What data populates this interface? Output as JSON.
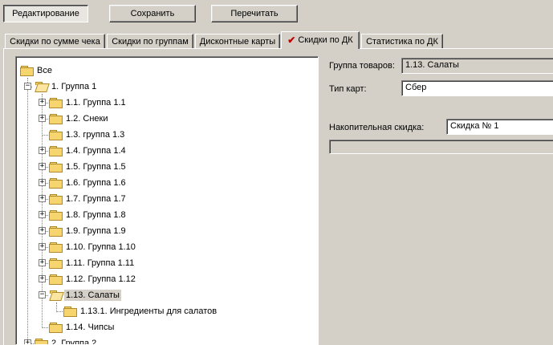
{
  "toolbar": {
    "edit_label": "Редактирование",
    "save_label": "Сохранить",
    "reload_label": "Перечитать"
  },
  "tabs": [
    {
      "label": "Скидки по сумме чека"
    },
    {
      "label": "Скидки по группам"
    },
    {
      "label": "Дисконтные карты"
    },
    {
      "label": "Скидки по ДК",
      "active": true
    },
    {
      "label": "Статистика по ДК"
    }
  ],
  "icons": {
    "check": "check-icon",
    "folder": "folder-icon",
    "expand": "plus-box-icon",
    "collapse": "minus-box-icon"
  },
  "tree": [
    {
      "label": "Все"
    },
    {
      "label": "1. Группа 1"
    },
    {
      "label": "1.1. Группа 1.1"
    },
    {
      "label": "1.2. Снеки"
    },
    {
      "label": "1.3. группа 1.3"
    },
    {
      "label": "1.4. Группа 1.4"
    },
    {
      "label": "1.5. Группа 1.5"
    },
    {
      "label": "1.6. Группа 1.6"
    },
    {
      "label": "1.7. Группа 1.7"
    },
    {
      "label": "1.8. Группа 1.8"
    },
    {
      "label": "1.9. Группа 1.9"
    },
    {
      "label": "1.10. Группа 1.10"
    },
    {
      "label": "1.11. Группа 1.11"
    },
    {
      "label": "1.12. Группа 1.12"
    },
    {
      "label": "1.13. Салаты"
    },
    {
      "label": "1.13.1. Ингредиенты для салатов"
    },
    {
      "label": "1.14. Чипсы"
    },
    {
      "label": "2. Группа 2"
    }
  ],
  "form": {
    "group_label": "Группа товаров:",
    "group_value": "1.13. Салаты",
    "card_type_label": "Тип карт:",
    "card_type_value": "Сбер",
    "cumulative_label": "Накопительная скидка:",
    "cumulative_value": "Скидка № 1",
    "extra_value": ""
  }
}
